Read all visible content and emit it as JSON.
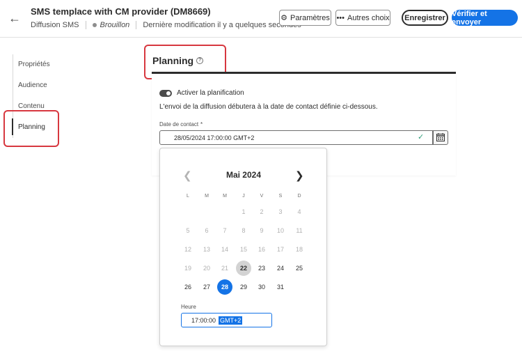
{
  "header": {
    "title": "SMS templace with CM provider (DM8669)",
    "channel": "Diffusion SMS",
    "status": "Brouillon",
    "last_modified": "Dernière modification il y a quelques secondes",
    "buttons": {
      "params": "Paramètres",
      "more": "Autres choix",
      "save": "Enregistrer",
      "verify": "Vérifier et envoyer"
    }
  },
  "nav": {
    "items": [
      "Propriétés",
      "Audience",
      "Contenu",
      "Planning"
    ],
    "active": "Planning"
  },
  "section": {
    "title": "Planning",
    "toggle_label": "Activer la planification",
    "toggle_on": true,
    "info": "L'envoi de la diffusion débutera à la date de contact définie ci-dessous.",
    "field_label": "Date de contact",
    "required_mark": "*",
    "date_value": "28/05/2024  17:00:00  GMT+2"
  },
  "calendar": {
    "month_label": "Mai 2024",
    "weekdays": [
      "L",
      "M",
      "M",
      "J",
      "V",
      "S",
      "D"
    ],
    "weeks": [
      [
        {
          "d": "",
          "t": "empty"
        },
        {
          "d": "",
          "t": "empty"
        },
        {
          "d": "",
          "t": "empty"
        },
        {
          "d": "1",
          "t": "outside"
        },
        {
          "d": "2",
          "t": "outside"
        },
        {
          "d": "3",
          "t": "outside"
        },
        {
          "d": "4",
          "t": "outside"
        }
      ],
      [
        {
          "d": "5",
          "t": "outside"
        },
        {
          "d": "6",
          "t": "outside"
        },
        {
          "d": "7",
          "t": "outside"
        },
        {
          "d": "8",
          "t": "outside"
        },
        {
          "d": "9",
          "t": "outside"
        },
        {
          "d": "10",
          "t": "outside"
        },
        {
          "d": "11",
          "t": "outside"
        }
      ],
      [
        {
          "d": "12",
          "t": "outside"
        },
        {
          "d": "13",
          "t": "outside"
        },
        {
          "d": "14",
          "t": "outside"
        },
        {
          "d": "15",
          "t": "outside"
        },
        {
          "d": "16",
          "t": "outside"
        },
        {
          "d": "17",
          "t": "outside"
        },
        {
          "d": "18",
          "t": "outside"
        }
      ],
      [
        {
          "d": "19",
          "t": "outside"
        },
        {
          "d": "20",
          "t": "outside"
        },
        {
          "d": "21",
          "t": "outside"
        },
        {
          "d": "22",
          "t": "today"
        },
        {
          "d": "23",
          "t": "normal"
        },
        {
          "d": "24",
          "t": "normal"
        },
        {
          "d": "25",
          "t": "normal"
        }
      ],
      [
        {
          "d": "26",
          "t": "normal"
        },
        {
          "d": "27",
          "t": "normal"
        },
        {
          "d": "28",
          "t": "selected"
        },
        {
          "d": "29",
          "t": "normal"
        },
        {
          "d": "30",
          "t": "normal"
        },
        {
          "d": "31",
          "t": "normal"
        },
        {
          "d": "",
          "t": "empty"
        }
      ]
    ],
    "time_label": "Heure",
    "time_value": "17:00:00",
    "timezone": "GMT+2"
  },
  "colors": {
    "accent": "#1473e6",
    "highlight": "#d7373f",
    "success": "#2d9d78"
  }
}
